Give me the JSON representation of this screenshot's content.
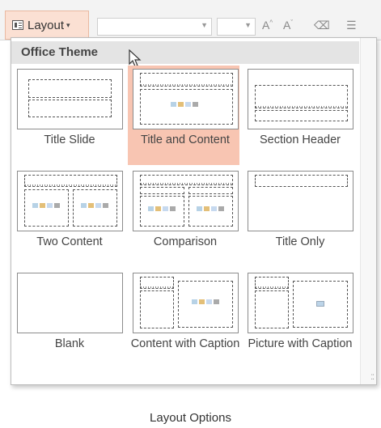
{
  "ribbon": {
    "layout_label": "Layout",
    "caret": "▾"
  },
  "panel": {
    "header": "Office Theme"
  },
  "layouts": [
    {
      "label": "Title Slide",
      "selected": false
    },
    {
      "label": "Title and Content",
      "selected": true
    },
    {
      "label": "Section Header",
      "selected": false
    },
    {
      "label": "Two Content",
      "selected": false
    },
    {
      "label": "Comparison",
      "selected": false
    },
    {
      "label": "Title Only",
      "selected": false
    },
    {
      "label": "Blank",
      "selected": false
    },
    {
      "label": "Content with Caption",
      "selected": false
    },
    {
      "label": "Picture with Caption",
      "selected": false
    }
  ],
  "caption": "Layout Options",
  "colors": {
    "selected_tile": "#f8c5b2",
    "button_highlight": "#fbe0d3"
  }
}
